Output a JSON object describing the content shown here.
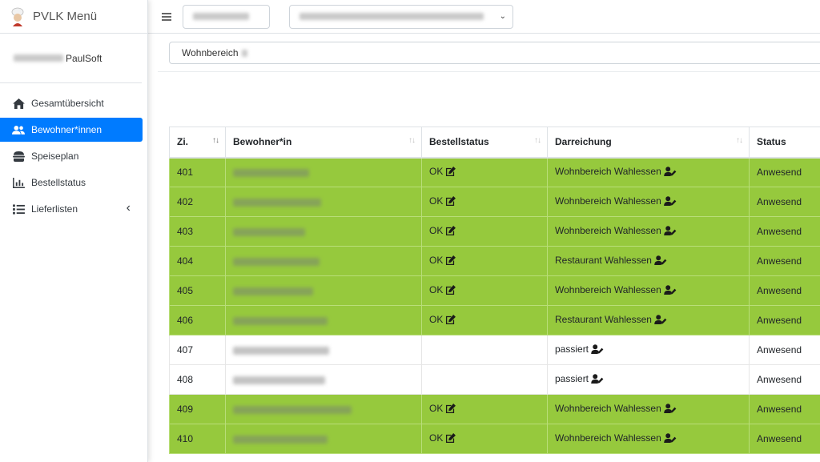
{
  "app": {
    "title": "PVLK Menü",
    "user_name": "PaulSoft"
  },
  "sidebar": {
    "items": [
      {
        "label": "Gesamtübersicht",
        "icon": "home-icon",
        "active": false
      },
      {
        "label": "Bewohner*innen",
        "icon": "users-icon",
        "active": true
      },
      {
        "label": "Speiseplan",
        "icon": "burger-icon",
        "active": false
      },
      {
        "label": "Bestellstatus",
        "icon": "bar-chart-icon",
        "active": false
      },
      {
        "label": "Lieferlisten",
        "icon": "list-icon",
        "active": false,
        "expandable": true
      }
    ]
  },
  "filter": {
    "value": "Wohnbereich"
  },
  "table": {
    "columns": [
      "Zi.",
      "Bewohner*in",
      "Bestellstatus",
      "Darreichung",
      "Status"
    ],
    "rows": [
      {
        "room": "401",
        "order_status": "OK",
        "serving": "Wohnbereich Wahlessen",
        "status": "Anwesend",
        "highlight": true
      },
      {
        "room": "402",
        "order_status": "OK",
        "serving": "Wohnbereich Wahlessen",
        "status": "Anwesend",
        "highlight": true
      },
      {
        "room": "403",
        "order_status": "OK",
        "serving": "Wohnbereich Wahlessen",
        "status": "Anwesend",
        "highlight": true
      },
      {
        "room": "404",
        "order_status": "OK",
        "serving": "Restaurant Wahlessen",
        "status": "Anwesend",
        "highlight": true
      },
      {
        "room": "405",
        "order_status": "OK",
        "serving": "Wohnbereich Wahlessen",
        "status": "Anwesend",
        "highlight": true
      },
      {
        "room": "406",
        "order_status": "OK",
        "serving": "Restaurant Wahlessen",
        "status": "Anwesend",
        "highlight": true
      },
      {
        "room": "407",
        "order_status": "",
        "serving": "passiert",
        "status": "Anwesend",
        "highlight": false
      },
      {
        "room": "408",
        "order_status": "",
        "serving": "passiert",
        "status": "Anwesend",
        "highlight": false
      },
      {
        "room": "409",
        "order_status": "OK",
        "serving": "Wohnbereich Wahlessen",
        "status": "Anwesend",
        "highlight": true
      },
      {
        "room": "410",
        "order_status": "OK",
        "serving": "Wohnbereich Wahlessen",
        "status": "Anwesend",
        "highlight": true
      }
    ]
  },
  "colors": {
    "accent": "#007bff",
    "row_highlight": "#96c93d"
  }
}
